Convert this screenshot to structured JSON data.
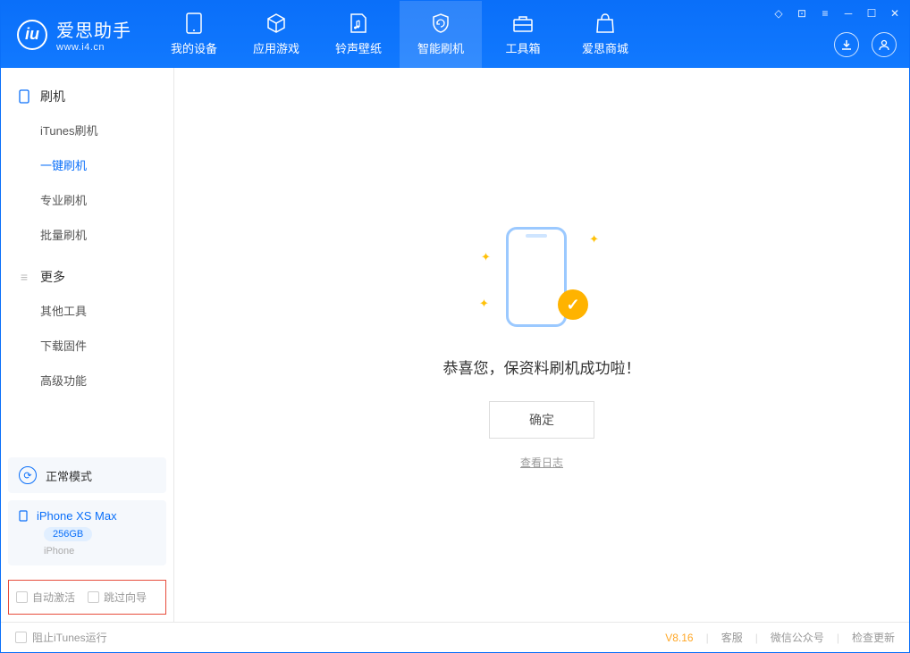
{
  "app": {
    "title": "爱思助手",
    "url": "www.i4.cn"
  },
  "tabs": [
    {
      "label": "我的设备"
    },
    {
      "label": "应用游戏"
    },
    {
      "label": "铃声壁纸"
    },
    {
      "label": "智能刷机"
    },
    {
      "label": "工具箱"
    },
    {
      "label": "爱思商城"
    }
  ],
  "sidebar": {
    "group1": {
      "title": "刷机",
      "items": [
        "iTunes刷机",
        "一键刷机",
        "专业刷机",
        "批量刷机"
      ]
    },
    "group2": {
      "title": "更多",
      "items": [
        "其他工具",
        "下载固件",
        "高级功能"
      ]
    }
  },
  "device": {
    "mode": "正常模式",
    "name": "iPhone XS Max",
    "storage": "256GB",
    "type": "iPhone"
  },
  "options": {
    "auto_activate": "自动激活",
    "skip_guide": "跳过向导"
  },
  "main": {
    "message": "恭喜您，保资料刷机成功啦！",
    "ok": "确定",
    "view_log": "查看日志"
  },
  "footer": {
    "block_itunes": "阻止iTunes运行",
    "version": "V8.16",
    "support": "客服",
    "wechat": "微信公众号",
    "update": "检查更新"
  }
}
